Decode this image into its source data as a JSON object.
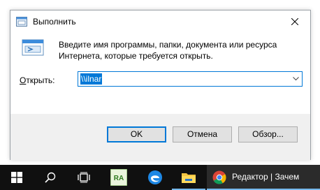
{
  "dialog": {
    "title": "Выполнить",
    "description": "Введите имя программы, папки, документа или ресурса Интернета, которые требуется открыть.",
    "open_label_prefix": "",
    "open_label_underlined": "О",
    "open_label_rest": "ткрыть:",
    "input_value": "\\\\ilnar",
    "buttons": {
      "ok": "OK",
      "cancel": "Отмена",
      "browse": "Обзор..."
    }
  },
  "taskbar": {
    "items": [
      {
        "name": "start",
        "icon": "windows-logo-icon"
      },
      {
        "name": "search",
        "icon": "search-icon"
      },
      {
        "name": "task-view",
        "icon": "task-view-icon"
      },
      {
        "name": "ra-app",
        "icon": "ra-app-icon",
        "label": "RA"
      },
      {
        "name": "edge",
        "icon": "edge-icon"
      },
      {
        "name": "file-explorer",
        "icon": "folder-icon"
      }
    ],
    "active_window_label": "Редактор | Зачем"
  },
  "colors": {
    "accent": "#0078d7",
    "taskbar": "#101010",
    "footer": "#f0f0f0"
  }
}
